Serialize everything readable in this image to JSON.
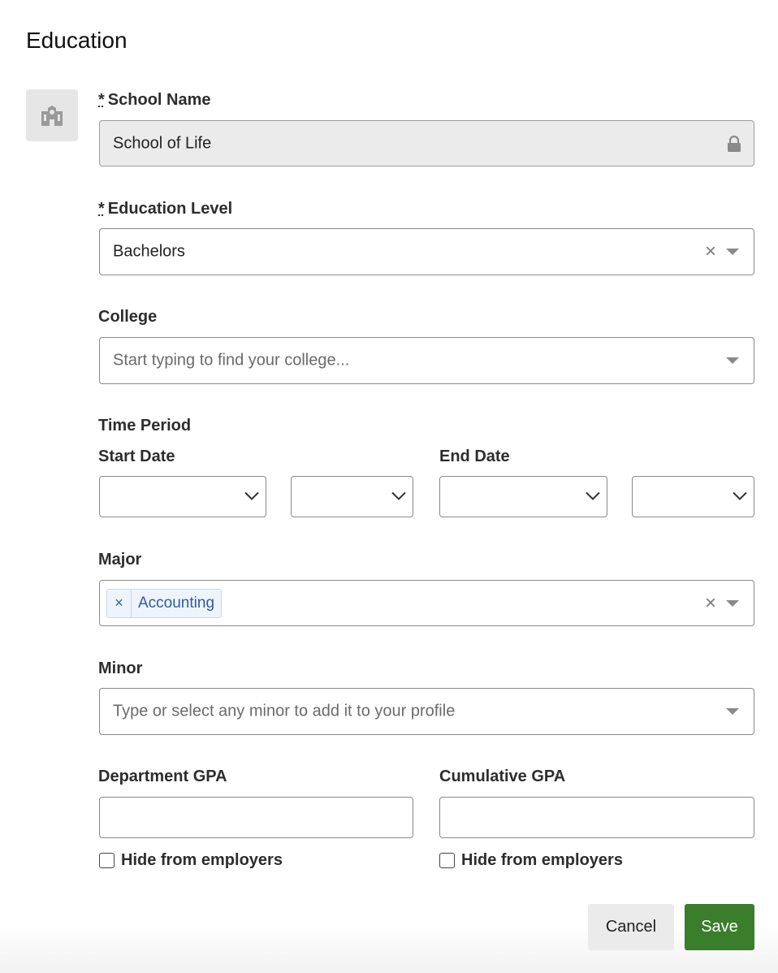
{
  "title": "Education",
  "school_name": {
    "label": "School Name",
    "required_mark": "*",
    "value": "School of Life"
  },
  "education_level": {
    "label": "Education Level",
    "required_mark": "*",
    "value": "Bachelors"
  },
  "college": {
    "label": "College",
    "placeholder": "Start typing to find your college..."
  },
  "time_period": {
    "label": "Time Period",
    "start_label": "Start Date",
    "end_label": "End Date"
  },
  "major": {
    "label": "Major",
    "tag": "Accounting",
    "tag_remove": "×"
  },
  "minor": {
    "label": "Minor",
    "placeholder": "Type or select any minor to add it to your profile"
  },
  "department_gpa": {
    "label": "Department GPA",
    "hide_label": "Hide from employers"
  },
  "cumulative_gpa": {
    "label": "Cumulative GPA",
    "hide_label": "Hide from employers"
  },
  "buttons": {
    "cancel": "Cancel",
    "save": "Save"
  },
  "colors": {
    "save_bg": "#3a7d2a",
    "tag_text": "#2f5c9e",
    "locked_bg": "#ebebeb"
  }
}
